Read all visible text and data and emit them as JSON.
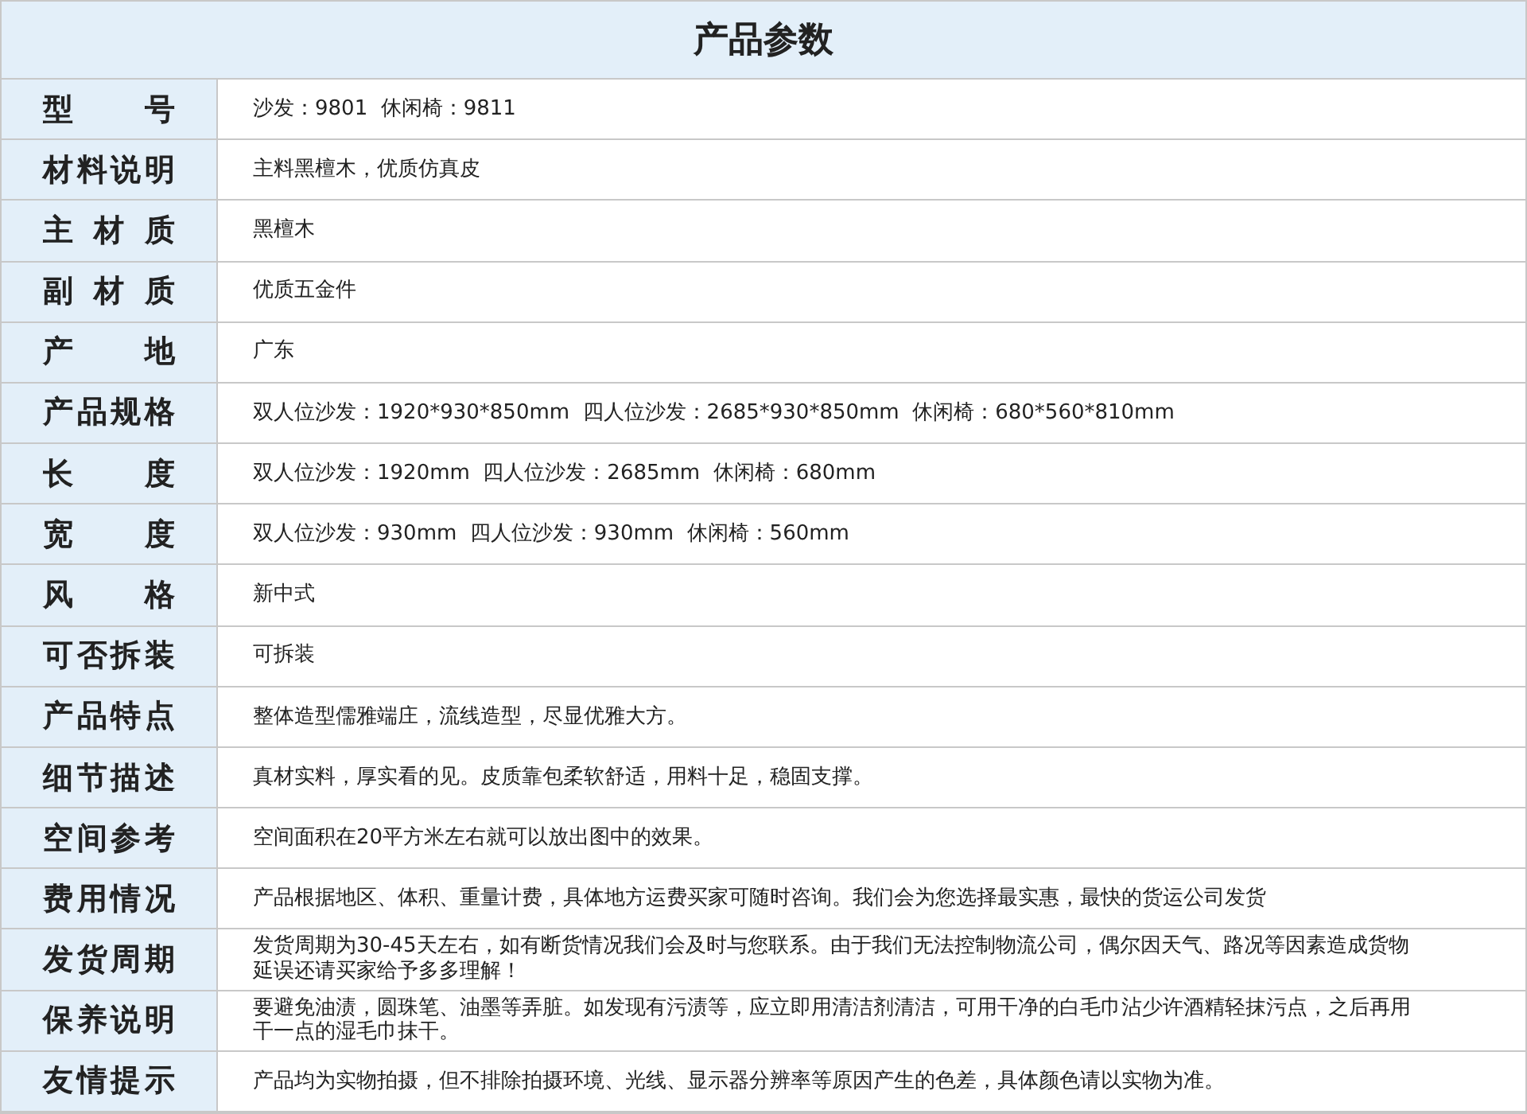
{
  "title": "产品参数",
  "rows": [
    {
      "label": "型 号",
      "value": "沙发：9801  休闲椅：9811"
    },
    {
      "label": "材料说明",
      "value": "主料黑檀木，优质仿真皮"
    },
    {
      "label": "主 材 质",
      "value": "黑檀木"
    },
    {
      "label": "副 材 质",
      "value": "优质五金件"
    },
    {
      "label": "产 地",
      "value": "广东"
    },
    {
      "label": "产品规格",
      "value": "双人位沙发：1920*930*850mm  四人位沙发：2685*930*850mm  休闲椅：680*560*810mm"
    },
    {
      "label": "长 度",
      "value": "双人位沙发：1920mm  四人位沙发：2685mm  休闲椅：680mm"
    },
    {
      "label": "宽 度",
      "value": "双人位沙发：930mm  四人位沙发：930mm  休闲椅：560mm"
    },
    {
      "label": "风 格",
      "value": "新中式"
    },
    {
      "label": "可否拆装",
      "value": "可拆装"
    },
    {
      "label": "产品特点",
      "value": "整体造型儒雅端庄，流线造型，尽显优雅大方。"
    },
    {
      "label": "细节描述",
      "value": "真材实料，厚实看的见。皮质靠包柔软舒适，用料十足，稳固支撑。"
    },
    {
      "label": "空间参考",
      "value": "空间面积在20平方米左右就可以放出图中的效果。"
    },
    {
      "label": "费用情况",
      "value": "产品根据地区、体积、重量计费，具体地方运费买家可随时咨询。我们会为您选择最实惠，最快的货运公司发货"
    },
    {
      "label": "发货周期",
      "value": "发货周期为30-45天左右，如有断货情况我们会及时与您联系。由于我们无法控制物流公司，偶尔因天气、路况等因素造成货物延误还请买家给予多多理解！"
    },
    {
      "label": "保养说明",
      "value": "要避免油渍，圆珠笔、油墨等弄脏。如发现有污渍等，应立即用清洁剂清洁，可用干净的白毛巾沾少许酒精轻抹污点，之后再用干一点的湿毛巾抹干。"
    },
    {
      "label": "友情提示",
      "value": "产品均为实物拍摄，但不排除拍摄环境、光线、显示器分辨率等原因产生的色差，具体颜色请以实物为准。"
    }
  ]
}
